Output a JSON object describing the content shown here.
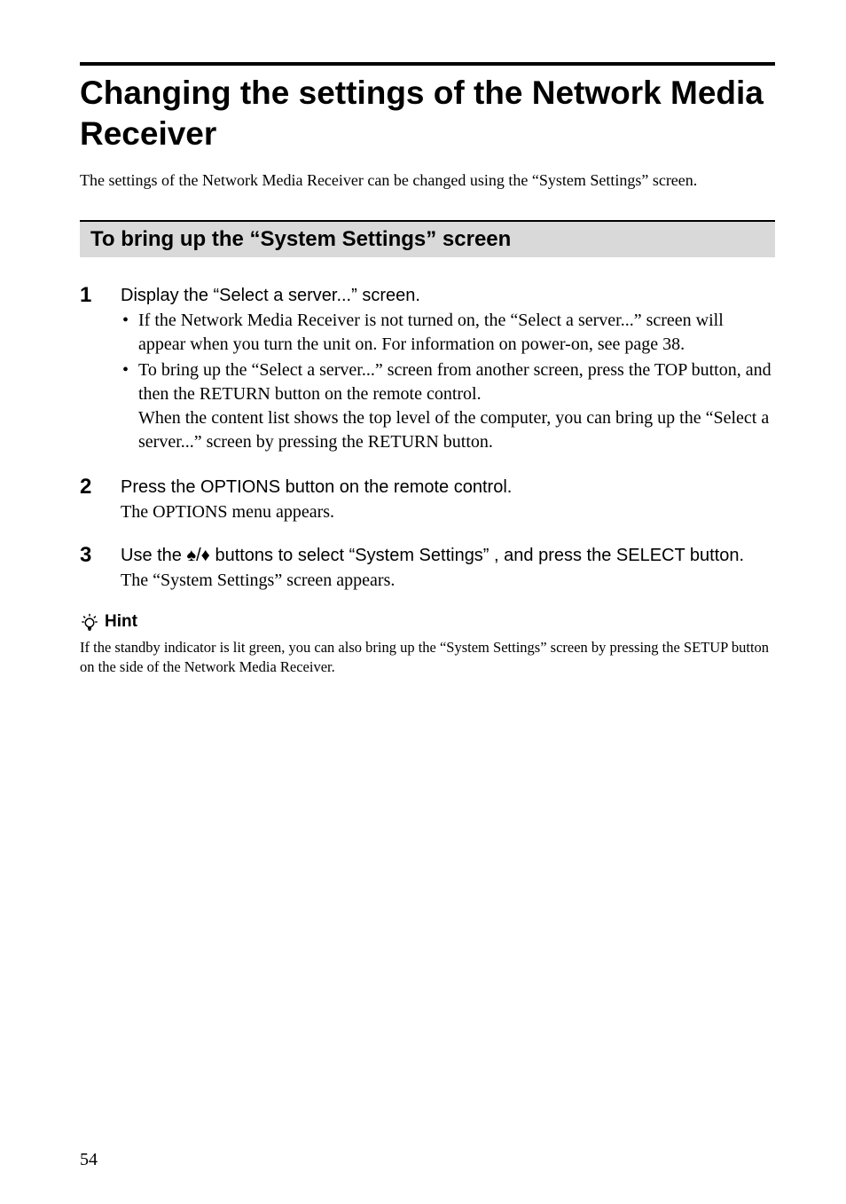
{
  "page_title": "Changing the settings of the Network Media Receiver",
  "intro": "The settings of the Network Media Receiver can be changed using the “System Settings” screen.",
  "section_heading": "To bring up the “System Settings” screen",
  "steps": [
    {
      "number": "1",
      "instruction": "Display the “Select a server...” screen.",
      "bullets": [
        "If the Network Media Receiver is not turned on, the “Select a server...” screen will appear when you turn the unit on. For information on power-on, see page 38.",
        "To bring up the “Select a server...” screen from another screen, press the TOP button, and then the RETURN button on the remote control.\nWhen the content list shows the top level of the computer, you can bring up the “Select a server...” screen by pressing the RETURN button."
      ]
    },
    {
      "number": "2",
      "instruction": "Press the OPTIONS button on the remote control.",
      "result": "The OPTIONS menu appears."
    },
    {
      "number": "3",
      "instruction": "Use the ↑/↓ buttons to select “System Settings” , and press the SELECT button.",
      "result": "The “System Settings” screen appears."
    }
  ],
  "hint_label": "Hint",
  "hint_text": "If the standby indicator is lit green, you can also bring up the “System Settings” screen by pressing the SETUP button on the side of the Network Media Receiver.",
  "page_number": "54"
}
